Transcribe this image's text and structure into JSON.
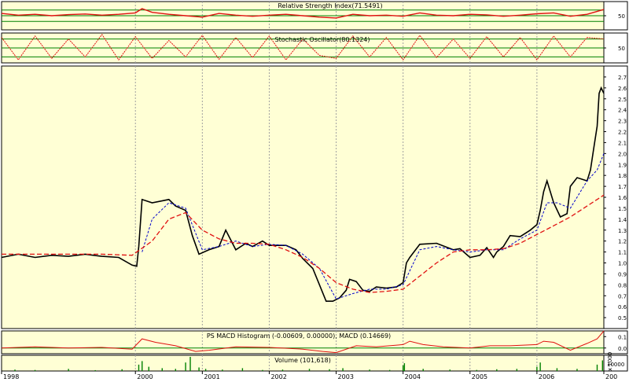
{
  "colors": {
    "panel_bg": "#ffffd5",
    "axis_bg": "#ffffff",
    "price_bar": "#000000",
    "ma_short": "#0000cc",
    "ma_long": "#e01010",
    "indicator_line": "#e01010",
    "ref_line": "#008000",
    "vgrid": "#a0a0a0",
    "border": "#000000"
  },
  "chart_data": [
    {
      "type": "line",
      "panel": "rsi",
      "title": "Relative Strength Index(71.5491)",
      "ref_levels": [
        30,
        50,
        70
      ],
      "ylim": [
        0,
        100
      ],
      "y_ticks": [
        {
          "value": 50,
          "label": "50"
        }
      ],
      "series": [
        {
          "name": "RSI",
          "x": [
            1998.0,
            1998.25,
            1998.5,
            1998.75,
            1999.0,
            1999.25,
            1999.5,
            1999.75,
            2000.0,
            2000.1,
            2000.25,
            2000.5,
            2000.75,
            2001.0,
            2001.25,
            2001.5,
            2001.75,
            2002.0,
            2002.25,
            2002.5,
            2002.75,
            2003.0,
            2003.25,
            2003.5,
            2003.75,
            2004.0,
            2004.25,
            2004.5,
            2004.75,
            2005.0,
            2005.25,
            2005.5,
            2005.75,
            2006.0,
            2006.25,
            2006.5,
            2006.75,
            2007.0
          ],
          "values": [
            58,
            52,
            55,
            50,
            54,
            56,
            52,
            55,
            60,
            75,
            62,
            55,
            50,
            45,
            58,
            52,
            48,
            52,
            55,
            50,
            45,
            42,
            55,
            50,
            52,
            48,
            60,
            52,
            50,
            55,
            53,
            48,
            52,
            57,
            60,
            48,
            55,
            72
          ]
        }
      ]
    },
    {
      "type": "line",
      "panel": "stochastic",
      "title": "Stochastic Oscillator(80.1324)",
      "ref_levels": [
        20,
        50,
        80
      ],
      "ylim": [
        0,
        100
      ],
      "y_ticks": [
        {
          "value": 50,
          "label": "50"
        }
      ],
      "series": [
        {
          "name": "%K",
          "x": [
            1998.0,
            1998.25,
            1998.5,
            1998.75,
            1999.0,
            1999.25,
            1999.5,
            1999.75,
            2000.0,
            2000.25,
            2000.5,
            2000.75,
            2001.0,
            2001.25,
            2001.5,
            2001.75,
            2002.0,
            2002.25,
            2002.5,
            2002.75,
            2003.0,
            2003.25,
            2003.5,
            2003.75,
            2004.0,
            2004.25,
            2004.5,
            2004.75,
            2005.0,
            2005.25,
            2005.5,
            2005.75,
            2006.0,
            2006.25,
            2006.5,
            2006.75,
            2007.0
          ],
          "values": [
            85,
            10,
            90,
            15,
            80,
            20,
            95,
            10,
            88,
            15,
            75,
            20,
            92,
            12,
            85,
            18,
            90,
            10,
            80,
            25,
            15,
            90,
            20,
            85,
            10,
            92,
            18,
            80,
            15,
            88,
            20,
            85,
            10,
            90,
            20,
            85,
            80
          ]
        }
      ]
    },
    {
      "type": "line",
      "panel": "price",
      "title": "",
      "ylim": [
        0.4,
        2.8
      ],
      "y_ticks": [
        {
          "value": 0.5,
          "label": "0.5"
        },
        {
          "value": 0.6,
          "label": "0.6"
        },
        {
          "value": 0.7,
          "label": "0.7"
        },
        {
          "value": 0.8,
          "label": "0.8"
        },
        {
          "value": 0.9,
          "label": "0.9"
        },
        {
          "value": 1.0,
          "label": "1.0"
        },
        {
          "value": 1.1,
          "label": "1.1"
        },
        {
          "value": 1.2,
          "label": "1.2"
        },
        {
          "value": 1.3,
          "label": "1.3"
        },
        {
          "value": 1.4,
          "label": "1.4"
        },
        {
          "value": 1.5,
          "label": "1.5"
        },
        {
          "value": 1.6,
          "label": "1.6"
        },
        {
          "value": 1.7,
          "label": "1.7"
        },
        {
          "value": 1.8,
          "label": "1.8"
        },
        {
          "value": 1.9,
          "label": "1.9"
        },
        {
          "value": 2.0,
          "label": "2.0"
        },
        {
          "value": 2.1,
          "label": "2.1"
        },
        {
          "value": 2.2,
          "label": "2.2"
        },
        {
          "value": 2.3,
          "label": "2.3"
        },
        {
          "value": 2.4,
          "label": "2.4"
        },
        {
          "value": 2.5,
          "label": "2.5"
        },
        {
          "value": 2.6,
          "label": "2.6"
        },
        {
          "value": 2.7,
          "label": "2.7"
        }
      ],
      "series": [
        {
          "name": "price",
          "x": [
            1998.0,
            1998.25,
            1998.5,
            1998.75,
            1999.0,
            1999.25,
            1999.5,
            1999.75,
            1999.95,
            2000.02,
            2000.05,
            2000.1,
            2000.25,
            2000.5,
            2000.6,
            2000.75,
            2000.85,
            2000.95,
            2001.1,
            2001.25,
            2001.35,
            2001.5,
            2001.65,
            2001.75,
            2001.9,
            2002.0,
            2002.25,
            2002.4,
            2002.5,
            2002.65,
            2002.75,
            2002.85,
            2002.95,
            2003.05,
            2003.15,
            2003.2,
            2003.3,
            2003.4,
            2003.5,
            2003.6,
            2003.75,
            2003.9,
            2004.0,
            2004.05,
            2004.1,
            2004.25,
            2004.5,
            2004.75,
            2004.85,
            2005.0,
            2005.15,
            2005.25,
            2005.35,
            2005.4,
            2005.5,
            2005.6,
            2005.75,
            2005.9,
            2006.0,
            2006.05,
            2006.1,
            2006.15,
            2006.25,
            2006.35,
            2006.45,
            2006.5,
            2006.6,
            2006.75,
            2006.8,
            2006.85,
            2006.9,
            2006.93,
            2006.96,
            2007.0
          ],
          "values": [
            1.05,
            1.08,
            1.05,
            1.07,
            1.06,
            1.08,
            1.06,
            1.05,
            0.98,
            0.97,
            1.15,
            1.58,
            1.55,
            1.58,
            1.52,
            1.48,
            1.25,
            1.08,
            1.12,
            1.15,
            1.3,
            1.12,
            1.18,
            1.15,
            1.2,
            1.16,
            1.16,
            1.12,
            1.04,
            0.95,
            0.8,
            0.65,
            0.65,
            0.68,
            0.75,
            0.85,
            0.83,
            0.75,
            0.74,
            0.78,
            0.77,
            0.78,
            0.82,
            1.0,
            1.05,
            1.17,
            1.18,
            1.12,
            1.13,
            1.05,
            1.07,
            1.14,
            1.05,
            1.1,
            1.15,
            1.25,
            1.24,
            1.3,
            1.35,
            1.48,
            1.65,
            1.75,
            1.55,
            1.42,
            1.45,
            1.7,
            1.78,
            1.75,
            1.85,
            2.05,
            2.25,
            2.55,
            2.6,
            2.55
          ]
        },
        {
          "name": "short MA",
          "x": [
            2000.1,
            2000.25,
            2000.5,
            2000.75,
            2001.0,
            2001.25,
            2001.5,
            2001.75,
            2002.0,
            2002.25,
            2002.5,
            2002.75,
            2003.0,
            2003.25,
            2003.5,
            2003.75,
            2004.0,
            2004.25,
            2004.5,
            2004.75,
            2005.0,
            2005.25,
            2005.5,
            2005.75,
            2006.0,
            2006.15,
            2006.3,
            2006.5,
            2006.75,
            2006.9,
            2007.0
          ],
          "values": [
            1.1,
            1.4,
            1.55,
            1.5,
            1.12,
            1.15,
            1.2,
            1.15,
            1.17,
            1.16,
            1.08,
            0.95,
            0.67,
            0.72,
            0.76,
            0.76,
            0.8,
            1.12,
            1.15,
            1.12,
            1.1,
            1.12,
            1.12,
            1.22,
            1.3,
            1.55,
            1.55,
            1.5,
            1.75,
            1.85,
            2.0
          ]
        },
        {
          "name": "long MA",
          "x": [
            1998.0,
            1998.5,
            1999.0,
            1999.5,
            1999.95,
            2000.25,
            2000.5,
            2000.75,
            2001.0,
            2001.25,
            2001.5,
            2001.75,
            2002.0,
            2002.25,
            2002.5,
            2002.75,
            2003.0,
            2003.25,
            2003.5,
            2003.75,
            2004.0,
            2004.25,
            2004.5,
            2004.75,
            2005.0,
            2005.25,
            2005.5,
            2005.75,
            2006.0,
            2006.25,
            2006.5,
            2006.75,
            2007.0
          ],
          "values": [
            1.08,
            1.08,
            1.08,
            1.08,
            1.07,
            1.2,
            1.4,
            1.46,
            1.3,
            1.22,
            1.18,
            1.18,
            1.17,
            1.12,
            1.05,
            0.95,
            0.82,
            0.76,
            0.73,
            0.74,
            0.76,
            0.88,
            1.0,
            1.1,
            1.12,
            1.12,
            1.13,
            1.18,
            1.26,
            1.34,
            1.42,
            1.52,
            1.62
          ]
        }
      ]
    },
    {
      "type": "line",
      "panel": "macd",
      "title": "PS MACD Histogram (-0.00609, 0.00000), MACD (0.14669)",
      "ylim": [
        -0.05,
        0.15
      ],
      "y_ticks": [
        {
          "value": 0.1,
          "label": "0.1"
        },
        {
          "value": 0.0,
          "label": "0.0"
        }
      ],
      "series": [
        {
          "name": "MACD",
          "x": [
            1998.0,
            1998.5,
            1999.0,
            1999.5,
            1999.95,
            2000.1,
            2000.3,
            2000.6,
            2000.9,
            2001.1,
            2001.5,
            2002.0,
            2002.5,
            2002.8,
            2003.0,
            2003.3,
            2003.6,
            2004.0,
            2004.1,
            2004.3,
            2004.6,
            2005.0,
            2005.3,
            2005.6,
            2006.0,
            2006.1,
            2006.25,
            2006.5,
            2006.75,
            2006.9,
            2007.0
          ],
          "values": [
            0.0,
            0.01,
            0.0,
            0.005,
            -0.01,
            0.08,
            0.05,
            0.02,
            -0.03,
            -0.02,
            0.01,
            0.005,
            -0.01,
            -0.03,
            -0.04,
            0.02,
            0.01,
            0.03,
            0.06,
            0.03,
            0.01,
            0.0,
            0.02,
            0.02,
            0.03,
            0.06,
            0.05,
            -0.02,
            0.04,
            0.08,
            0.15
          ]
        }
      ]
    },
    {
      "type": "bar",
      "panel": "volume",
      "title": "Volume (101,618)",
      "y_ticks": [
        {
          "value": 10000,
          "label": "10000"
        }
      ],
      "unit_label": "x 1000",
      "x": [
        1998.2,
        1998.5,
        1999.0,
        1999.4,
        1999.8,
        2000.05,
        2000.1,
        2000.2,
        2000.4,
        2000.6,
        2000.75,
        2000.82,
        2000.95,
        2001.05,
        2001.3,
        2001.6,
        2001.9,
        2002.2,
        2002.6,
        2002.9,
        2003.1,
        2003.5,
        2003.8,
        2004.0,
        2004.02,
        2004.3,
        2004.7,
        2005.1,
        2005.4,
        2005.7,
        2006.0,
        2006.05,
        2006.3,
        2006.6,
        2006.9,
        2006.98
      ],
      "values": [
        2000,
        1500,
        3000,
        1200,
        2500,
        9000,
        14000,
        6000,
        4000,
        3000,
        12000,
        20000,
        5000,
        3000,
        2000,
        4000,
        1500,
        2000,
        3000,
        2500,
        4000,
        2000,
        1500,
        8000,
        11000,
        3000,
        2000,
        1500,
        2500,
        3000,
        6000,
        12000,
        4000,
        3000,
        9000,
        15000
      ]
    }
  ],
  "x_axis": {
    "xlim": [
      1998.0,
      2007.0
    ],
    "gridlines": [
      2000,
      2001,
      2002,
      2003,
      2004,
      2005,
      2006
    ],
    "labels": [
      {
        "value": 1998.0,
        "label": "1998"
      },
      {
        "value": 2000.0,
        "label": "2000"
      },
      {
        "value": 2001.0,
        "label": "2001"
      },
      {
        "value": 2002.0,
        "label": "2002"
      },
      {
        "value": 2003.0,
        "label": "2003"
      },
      {
        "value": 2004.0,
        "label": "2004"
      },
      {
        "value": 2005.0,
        "label": "2005"
      },
      {
        "value": 2006.0,
        "label": "2006"
      },
      {
        "value": 2007.0,
        "label": "200"
      }
    ]
  }
}
